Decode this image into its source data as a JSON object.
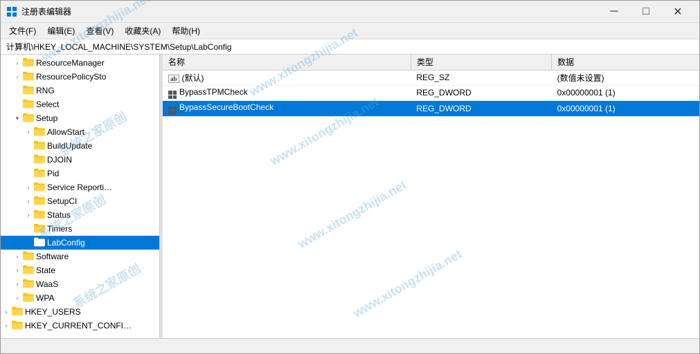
{
  "window": {
    "title": "注册表编辑器",
    "icon": "regedit"
  },
  "titlebar": {
    "minimize": "─",
    "maximize": "□",
    "close": "✕"
  },
  "menu": {
    "items": [
      "文件(F)",
      "编辑(E)",
      "查看(V)",
      "收藏夹(A)",
      "帮助(H)"
    ]
  },
  "address": {
    "label": "计算机\\HKEY_LOCAL_MACHINE\\SYSTEM\\Setup\\LabConfig"
  },
  "tree": {
    "items": [
      {
        "id": "resource-manager",
        "label": "ResourceManager",
        "indent": 1,
        "expanded": false,
        "hasChildren": true
      },
      {
        "id": "resource-policy",
        "label": "ResourcePolicySto",
        "indent": 1,
        "expanded": false,
        "hasChildren": true
      },
      {
        "id": "rng",
        "label": "RNG",
        "indent": 1,
        "expanded": false,
        "hasChildren": false
      },
      {
        "id": "select",
        "label": "Select",
        "indent": 1,
        "expanded": false,
        "hasChildren": false
      },
      {
        "id": "setup",
        "label": "Setup",
        "indent": 1,
        "expanded": true,
        "hasChildren": true
      },
      {
        "id": "allowstart",
        "label": "AllowStart",
        "indent": 2,
        "expanded": false,
        "hasChildren": true
      },
      {
        "id": "buildupdate",
        "label": "BuildUpdate",
        "indent": 2,
        "expanded": false,
        "hasChildren": false
      },
      {
        "id": "djoin",
        "label": "DJOIN",
        "indent": 2,
        "expanded": false,
        "hasChildren": false
      },
      {
        "id": "pid",
        "label": "Pid",
        "indent": 2,
        "expanded": false,
        "hasChildren": false
      },
      {
        "id": "service-reporting",
        "label": "Service Reporti…",
        "indent": 2,
        "expanded": false,
        "hasChildren": true
      },
      {
        "id": "setupci",
        "label": "SetupCI",
        "indent": 2,
        "expanded": false,
        "hasChildren": true
      },
      {
        "id": "status",
        "label": "Status",
        "indent": 2,
        "expanded": false,
        "hasChildren": true
      },
      {
        "id": "timers",
        "label": "Timers",
        "indent": 2,
        "expanded": false,
        "hasChildren": false
      },
      {
        "id": "labconfig",
        "label": "LabConfig",
        "indent": 2,
        "expanded": false,
        "hasChildren": false,
        "selected": true
      },
      {
        "id": "software",
        "label": "Software",
        "indent": 1,
        "expanded": false,
        "hasChildren": true
      },
      {
        "id": "state",
        "label": "State",
        "indent": 1,
        "expanded": false,
        "hasChildren": true
      },
      {
        "id": "waas",
        "label": "WaaS",
        "indent": 1,
        "expanded": false,
        "hasChildren": true
      },
      {
        "id": "wpa",
        "label": "WPA",
        "indent": 1,
        "expanded": false,
        "hasChildren": true
      },
      {
        "id": "hkey-users",
        "label": "HKEY_USERS",
        "indent": 0,
        "expanded": false,
        "hasChildren": true
      },
      {
        "id": "hkey-current-config",
        "label": "HKEY_CURRENT_CONFI…",
        "indent": 0,
        "expanded": false,
        "hasChildren": true
      }
    ]
  },
  "detail": {
    "columns": [
      "名称",
      "类型",
      "数据"
    ],
    "rows": [
      {
        "id": "default",
        "name": "(默认)",
        "type": "REG_SZ",
        "value": "(数值未设置)",
        "iconType": "ab"
      },
      {
        "id": "bypass-tpm",
        "name": "BypassTPMCheck",
        "type": "REG_DWORD",
        "value": "0x00000001 (1)",
        "iconType": "grid"
      },
      {
        "id": "bypass-secure-boot",
        "name": "BypassSecureBootCheck",
        "type": "REG_DWORD",
        "value": "0x00000001 (1)",
        "iconType": "grid",
        "selected": true
      }
    ]
  },
  "statusbar": {
    "text": ""
  }
}
